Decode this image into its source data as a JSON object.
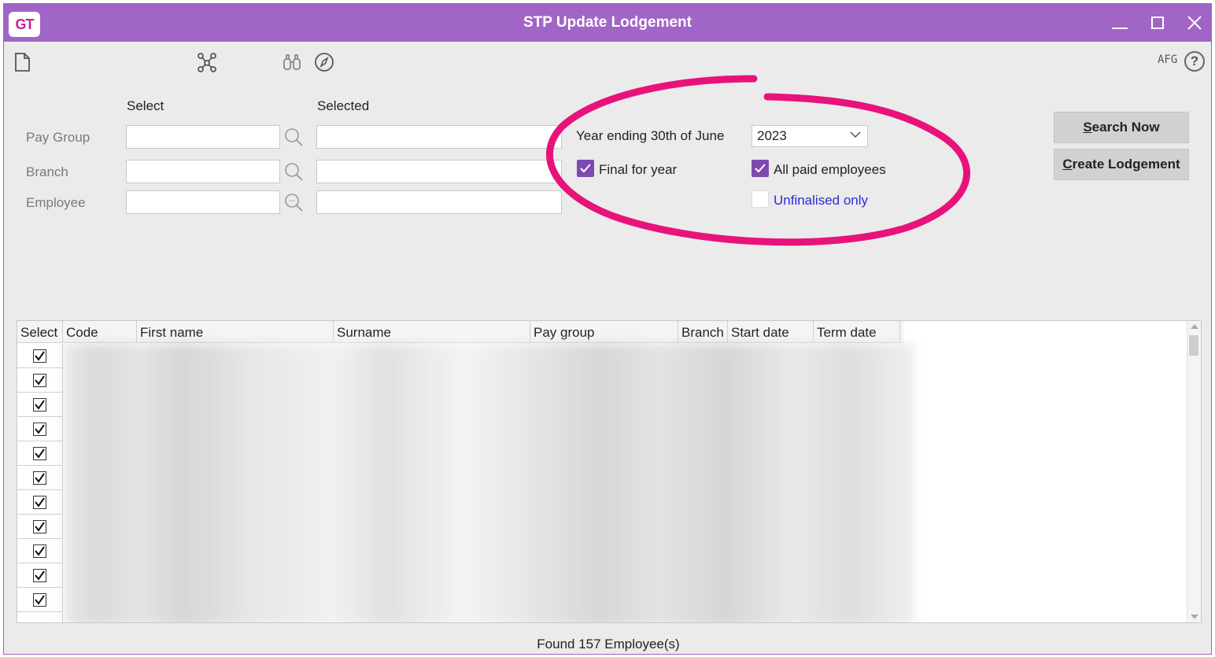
{
  "window": {
    "title": "STP Update Lodgement",
    "logo_text": "GT"
  },
  "toolbar": {
    "afg_label": "AFG",
    "help_label": "?"
  },
  "filters": {
    "select_header": "Select",
    "selected_header": "Selected",
    "fields": [
      {
        "label": "Pay Group",
        "value": "",
        "selected": ""
      },
      {
        "label": "Branch",
        "value": "",
        "selected": ""
      },
      {
        "label": "Employee",
        "value": "",
        "selected": ""
      }
    ]
  },
  "options": {
    "year_label": "Year ending 30th of June",
    "year_value": "2023",
    "final_for_year_label": "Final for year",
    "final_for_year_checked": true,
    "all_paid_label": "All paid employees",
    "all_paid_checked": true,
    "unfinalised_label": "Unfinalised only",
    "unfinalised_checked": false
  },
  "buttons": {
    "search_first": "S",
    "search_rest": "earch Now",
    "create_first": "C",
    "create_rest": "reate Lodgement"
  },
  "grid": {
    "columns": [
      "Select",
      "Code",
      "First name",
      "Surname",
      "Pay group",
      "Branch",
      "Start date",
      "Term date"
    ],
    "visible_rows_checked": [
      true,
      true,
      true,
      true,
      true,
      true,
      true,
      true,
      true,
      true,
      true
    ]
  },
  "status": {
    "text": "Found 157 Employee(s)"
  },
  "colors": {
    "titlebar": "#a065c6",
    "checkbox_accent": "#7d4ab0",
    "highlight_ring": "#e8137a",
    "link_blue": "#2b2bd9"
  }
}
